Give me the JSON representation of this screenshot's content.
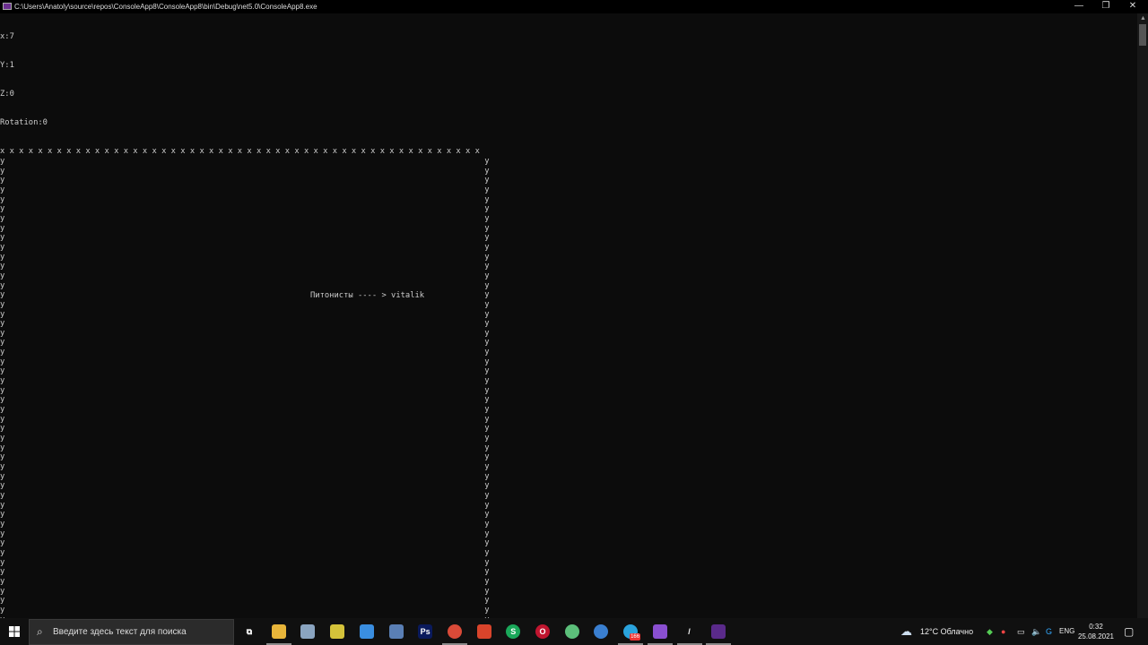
{
  "window": {
    "title": "C:\\Users\\Anatoly\\source\\repos\\ConsoleApp8\\ConsoleApp8\\bin\\Debug\\net5.0\\ConsoleApp8.exe",
    "minimize": "—",
    "maximize": "❐",
    "close": "✕"
  },
  "console": {
    "header_lines": [
      "x:7",
      "Y:1",
      "Z:0",
      "Rotation:0"
    ],
    "border_char": "x",
    "border_count": 51,
    "side_char": "y",
    "side_rows": 51,
    "message": "Питонисты ---- > vitalik"
  },
  "taskbar": {
    "search_placeholder": "Введите здесь текст для поиска",
    "apps": [
      {
        "name": "task-view",
        "glyph": "⧉",
        "color": "#101010"
      },
      {
        "name": "file-explorer",
        "glyph": "",
        "color": "#e8b53a"
      },
      {
        "name": "network-app",
        "glyph": "",
        "color": "#8aa4c0"
      },
      {
        "name": "sticky-app",
        "glyph": "",
        "color": "#d4c23a"
      },
      {
        "name": "remote-app",
        "glyph": "",
        "color": "#3a8ee0"
      },
      {
        "name": "calculator",
        "glyph": "",
        "color": "#5a7fb5"
      },
      {
        "name": "photoshop",
        "glyph": "Ps",
        "color": "#0a1a5c"
      },
      {
        "name": "chrome",
        "glyph": "",
        "color": "#d94a38"
      },
      {
        "name": "ccleaner",
        "glyph": "",
        "color": "#d9442b"
      },
      {
        "name": "skype-s",
        "glyph": "S",
        "color": "#1aa85a"
      },
      {
        "name": "opera",
        "glyph": "O",
        "color": "#c0152f"
      },
      {
        "name": "green-app",
        "glyph": "",
        "color": "#5cbf7a"
      },
      {
        "name": "blue-app",
        "glyph": "",
        "color": "#3a7fd0"
      },
      {
        "name": "telegram",
        "glyph": "",
        "color": "#2aa3dd"
      },
      {
        "name": "visual-studio",
        "glyph": "",
        "color": "#8a4fd0"
      },
      {
        "name": "pen-app",
        "glyph": "/",
        "color": "#101010"
      },
      {
        "name": "console-app",
        "glyph": "",
        "color": "#5a2a8a"
      }
    ],
    "telegram_badge": "166",
    "weather": "12°C  Облачно",
    "language": "ENG",
    "time": "0:32",
    "date": "25.08.2021"
  }
}
